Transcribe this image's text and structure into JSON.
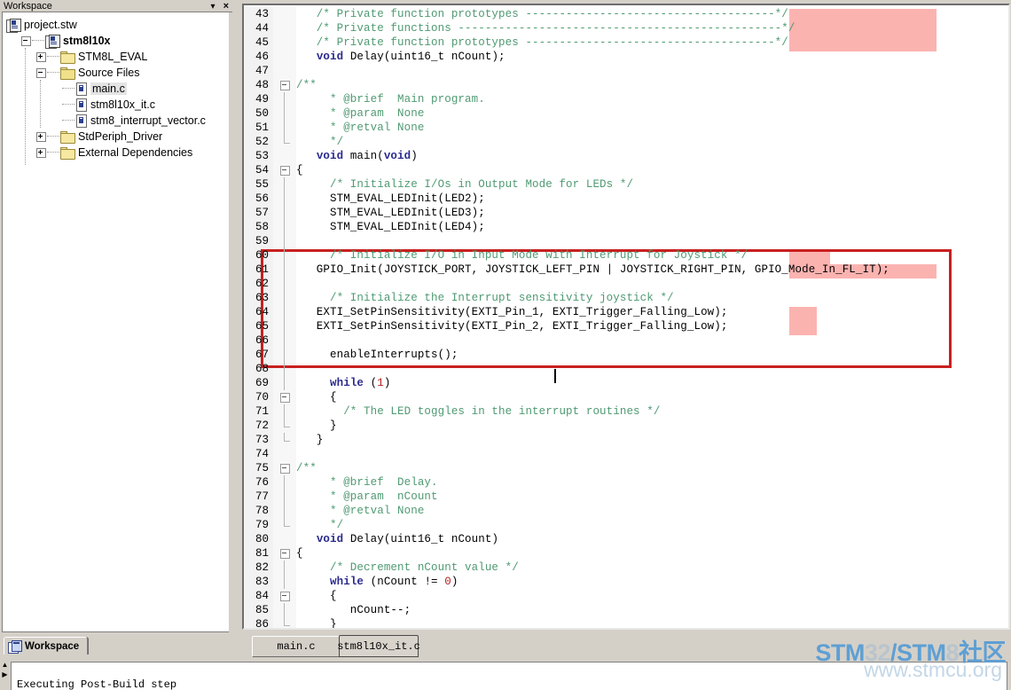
{
  "workspace": {
    "title": "Workspace",
    "tab_label": "Workspace",
    "dropdown_glyph": "▾",
    "close_glyph": "×",
    "tree": [
      {
        "label": "project.stw",
        "icon": "project-icon",
        "depth": 0,
        "bold": false,
        "expander": "none"
      },
      {
        "label": "stm8l10x",
        "icon": "project-icon",
        "depth": 1,
        "bold": true,
        "expander": "minus"
      },
      {
        "label": "STM8L_EVAL",
        "icon": "folder-icon",
        "depth": 2,
        "bold": false,
        "expander": "plus"
      },
      {
        "label": "Source Files",
        "icon": "folder-open-icon",
        "depth": 2,
        "bold": false,
        "expander": "minus"
      },
      {
        "label": "main.c",
        "icon": "c-file-icon",
        "depth": 3,
        "bold": false,
        "expander": "none",
        "selected": true
      },
      {
        "label": "stm8l10x_it.c",
        "icon": "c-file-icon",
        "depth": 3,
        "bold": false,
        "expander": "none"
      },
      {
        "label": "stm8_interrupt_vector.c",
        "icon": "c-file-icon",
        "depth": 3,
        "bold": false,
        "expander": "none"
      },
      {
        "label": "StdPeriph_Driver",
        "icon": "folder-icon",
        "depth": 2,
        "bold": false,
        "expander": "plus"
      },
      {
        "label": "External Dependencies",
        "icon": "folder-icon",
        "depth": 2,
        "bold": false,
        "expander": "plus"
      }
    ]
  },
  "editor": {
    "tabs": [
      {
        "label": "main.c",
        "active": false
      },
      {
        "label": "stm8l10x_it.c",
        "active": true
      }
    ],
    "first_line_number": 43,
    "lines": [
      {
        "n": 43,
        "text": "   /* Private function prototypes -------------------------------------*/"
      },
      {
        "n": 44,
        "text": "   /* Private functions ------------------------------------------------*/"
      },
      {
        "n": 45,
        "text": "   /* Private function prototypes -------------------------------------*/"
      },
      {
        "n": 46,
        "text": "   void Delay(uint16_t nCount);"
      },
      {
        "n": 47,
        "text": ""
      },
      {
        "n": 48,
        "text": "/**"
      },
      {
        "n": 49,
        "text": "     * @brief  Main program."
      },
      {
        "n": 50,
        "text": "     * @param  None"
      },
      {
        "n": 51,
        "text": "     * @retval None"
      },
      {
        "n": 52,
        "text": "     */"
      },
      {
        "n": 53,
        "text": "   void main(void)"
      },
      {
        "n": 54,
        "text": "{"
      },
      {
        "n": 55,
        "text": "     /* Initialize I/Os in Output Mode for LEDs */"
      },
      {
        "n": 56,
        "text": "     STM_EVAL_LEDInit(LED2);"
      },
      {
        "n": 57,
        "text": "     STM_EVAL_LEDInit(LED3);"
      },
      {
        "n": 58,
        "text": "     STM_EVAL_LEDInit(LED4);"
      },
      {
        "n": 59,
        "text": ""
      },
      {
        "n": 60,
        "text": "     /* Initialize I/O in Input Mode with Interrupt for Joystick */"
      },
      {
        "n": 61,
        "text": "   GPIO_Init(JOYSTICK_PORT, JOYSTICK_LEFT_PIN | JOYSTICK_RIGHT_PIN, GPIO_Mode_In_FL_IT);"
      },
      {
        "n": 62,
        "text": ""
      },
      {
        "n": 63,
        "text": "     /* Initialize the Interrupt sensitivity joystick */"
      },
      {
        "n": 64,
        "text": "   EXTI_SetPinSensitivity(EXTI_Pin_1, EXTI_Trigger_Falling_Low);"
      },
      {
        "n": 65,
        "text": "   EXTI_SetPinSensitivity(EXTI_Pin_2, EXTI_Trigger_Falling_Low);"
      },
      {
        "n": 66,
        "text": ""
      },
      {
        "n": 67,
        "text": "     enableInterrupts();"
      },
      {
        "n": 68,
        "text": ""
      },
      {
        "n": 69,
        "text": "     while (1)"
      },
      {
        "n": 70,
        "text": "     {"
      },
      {
        "n": 71,
        "text": "       /* The LED toggles in the interrupt routines */"
      },
      {
        "n": 72,
        "text": "     }"
      },
      {
        "n": 73,
        "text": "   }"
      },
      {
        "n": 74,
        "text": ""
      },
      {
        "n": 75,
        "text": "/**"
      },
      {
        "n": 76,
        "text": "     * @brief  Delay."
      },
      {
        "n": 77,
        "text": "     * @param  nCount"
      },
      {
        "n": 78,
        "text": "     * @retval None"
      },
      {
        "n": 79,
        "text": "     */"
      },
      {
        "n": 80,
        "text": "   void Delay(uint16_t nCount)"
      },
      {
        "n": 81,
        "text": "{"
      },
      {
        "n": 82,
        "text": "     /* Decrement nCount value */"
      },
      {
        "n": 83,
        "text": "     while (nCount != 0)"
      },
      {
        "n": 84,
        "text": "     {"
      },
      {
        "n": 85,
        "text": "        nCount--;"
      },
      {
        "n": 86,
        "text": "     }"
      }
    ],
    "annotation_boxes": [
      {
        "name": "joystick-init-highlight",
        "lines": "60-67"
      }
    ],
    "colors": {
      "comment": "#4f9a72",
      "keyword": "#2b2b8f",
      "number": "#b02020",
      "annotation_red": "#c8201f",
      "column_overflow_pink": "#fbb3b0",
      "gutter_bg": "#f2f2f2"
    }
  },
  "output": {
    "text": "Executing  Post-Build step"
  },
  "watermark": {
    "line1_a": "STM",
    "line1_b": "32",
    "line1_c": "/STM",
    "line1_d": "8",
    "line1_e": "社区",
    "line2": "www.stmcu.org"
  }
}
